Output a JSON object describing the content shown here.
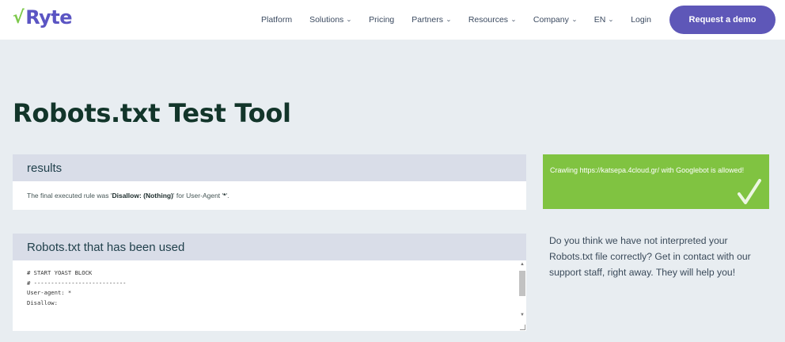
{
  "brand": {
    "logo_check": "√",
    "logo_text": "Ryte"
  },
  "nav": {
    "items": [
      {
        "label": "Platform",
        "dropdown": false
      },
      {
        "label": "Solutions",
        "dropdown": true
      },
      {
        "label": "Pricing",
        "dropdown": false
      },
      {
        "label": "Partners",
        "dropdown": true
      },
      {
        "label": "Resources",
        "dropdown": true
      },
      {
        "label": "Company",
        "dropdown": true
      },
      {
        "label": "EN",
        "dropdown": true
      },
      {
        "label": "Login",
        "dropdown": false
      }
    ],
    "cta_label": "Request a demo"
  },
  "page": {
    "title": "Robots.txt Test Tool"
  },
  "results": {
    "heading": "results",
    "text_prefix": "The final executed rule was '",
    "rule": "Disallow: (Nothing)",
    "text_middle": "' for User-Agent '",
    "agent": "*",
    "text_suffix": "'."
  },
  "robots_used": {
    "heading": "Robots.txt that has been used",
    "lines": [
      "# START YOAST BLOCK",
      "# ---------------------------",
      "User-agent: *",
      "Disallow:"
    ]
  },
  "status": {
    "message": "Crawling https://katsepa.4cloud.gr/ with Googlebot is allowed!"
  },
  "contact": {
    "text_before": "Do you think we have not interpreted your Robots.txt file correctly? Get in contact with ",
    "link": "our support staff",
    "text_after": ", right away. They will help you!"
  },
  "colors": {
    "accent": "#5e57b8",
    "success": "#80c341",
    "background": "#e8edf1",
    "panel_header": "#d9dde8"
  }
}
